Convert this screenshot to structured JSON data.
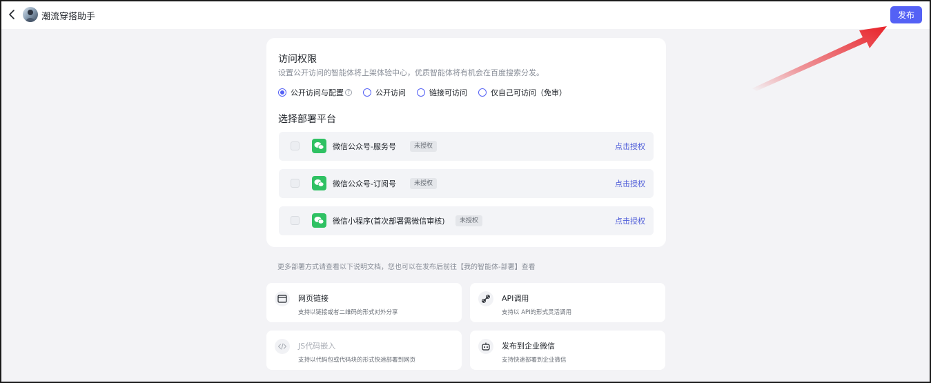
{
  "header": {
    "app_title": "潮流穿搭助手",
    "publish_label": "发布"
  },
  "access": {
    "title": "访问权限",
    "description": "设置公开访问的智能体将上架体验中心，优质智能体将有机会在百度搜索分发。",
    "options": [
      {
        "label": "公开访问与配置",
        "checked": true
      },
      {
        "label": "公开访问",
        "checked": false
      },
      {
        "label": "链接可访问",
        "checked": false
      },
      {
        "label": "仅自己可访问（免审）",
        "checked": false
      }
    ],
    "help_glyph": "?"
  },
  "platforms": {
    "title": "选择部署平台",
    "items": [
      {
        "name": "微信公众号-服务号",
        "badge": "未授权",
        "action": "点击授权"
      },
      {
        "name": "微信公众号-订阅号",
        "badge": "未授权",
        "action": "点击授权"
      },
      {
        "name": "微信小程序(首次部署需微信审核)",
        "badge": "未授权",
        "action": "点击授权"
      }
    ]
  },
  "more_note": "更多部署方式请查看以下说明文档，您也可以在发布后前往【我的智能体-部署】查看",
  "methods": [
    {
      "title": "网页链接",
      "desc": "支持以链接或者二维码的形式对外分享",
      "icon": "webpage-icon",
      "disabled": false
    },
    {
      "title": "API调用",
      "desc": "支持以 API的形式灵活调用",
      "icon": "api-icon",
      "disabled": false
    },
    {
      "title": "JS代码嵌入",
      "desc": "支持以代码包或代码块的形式快速部署到网页",
      "icon": "code-icon",
      "disabled": true
    },
    {
      "title": "发布到企业微信",
      "desc": "支持快速部署到企业微信",
      "icon": "robot-icon",
      "disabled": false
    }
  ],
  "colors": {
    "accent": "#5461f5",
    "wechat_green": "#2fc163",
    "link": "#4d5bd8",
    "arrow_red": "#e8232a"
  }
}
